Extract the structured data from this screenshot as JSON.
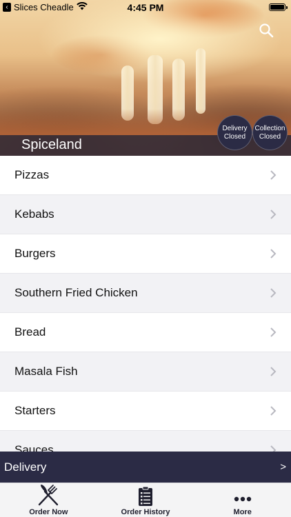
{
  "status_bar": {
    "back_app": "Slices Cheadle",
    "time": "4:45 PM"
  },
  "hero": {
    "restaurant_name": "Spiceland",
    "delivery_status": {
      "line1": "Delivery",
      "line2": "Closed"
    },
    "collection_status": {
      "line1": "Collection",
      "line2": "Closed"
    }
  },
  "menu": {
    "items": [
      {
        "label": "Pizzas"
      },
      {
        "label": "Kebabs"
      },
      {
        "label": "Burgers"
      },
      {
        "label": "Southern Fried Chicken"
      },
      {
        "label": "Bread"
      },
      {
        "label": "Masala Fish"
      },
      {
        "label": "Starters"
      },
      {
        "label": "Sauces"
      }
    ]
  },
  "delivery_bar": {
    "label": "Delivery",
    "arrow": ">"
  },
  "tab_bar": {
    "tabs": [
      {
        "label": "Order Now",
        "icon": "fork-knife-icon"
      },
      {
        "label": "Order History",
        "icon": "clipboard-list-icon"
      },
      {
        "label": "More",
        "icon": "more-dots-icon"
      }
    ]
  },
  "colors": {
    "brand_dark": "#2b2b45",
    "list_alt": "#f2f2f5"
  }
}
